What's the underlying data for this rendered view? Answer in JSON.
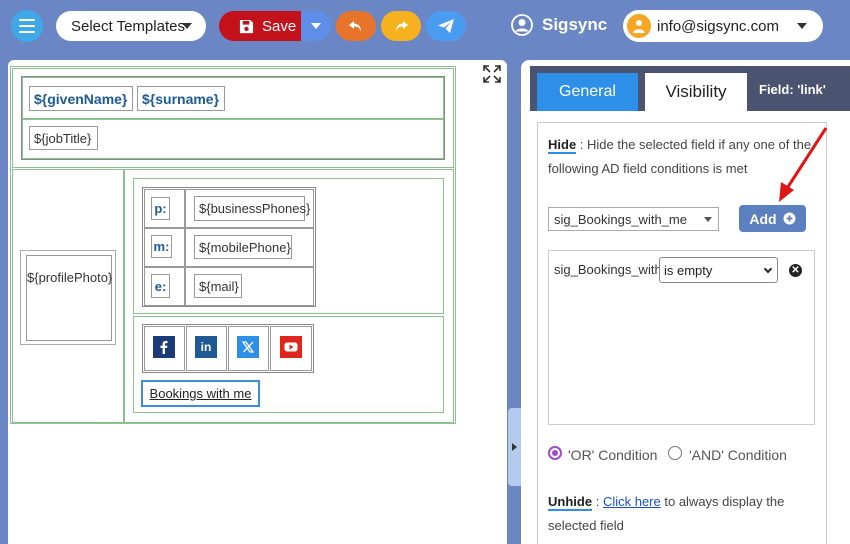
{
  "toolbar": {
    "templates_label": "Select Templates",
    "save_label": "Save",
    "brand": "Sigsync",
    "user_email": "info@sigsync.com"
  },
  "signature": {
    "given_name": "${givenName}",
    "surname": "${surname}",
    "job_title": "${jobTitle}",
    "photo": "${profilePhoto}",
    "phone_label": "p:",
    "phone_value": "${businessPhones}",
    "mobile_label": "m:",
    "mobile_value": "${mobilePhone}",
    "email_label": "e:",
    "email_value": "${mail}",
    "booking_label": "Bookings with me"
  },
  "panel": {
    "tab_general": "General",
    "tab_visibility": "Visibility",
    "field_prefix": "Field:",
    "field_name": "'link'",
    "hide_label": "Hide",
    "hide_desc_1": ": Hide the selected field if any one of the",
    "hide_desc_2": "following AD field conditions is met",
    "ad_field_value": "sig_Bookings_with_me",
    "add_label": "Add",
    "condition_field": "sig_Bookings_with",
    "condition_operator": "is empty",
    "or_label": "'OR' Condition",
    "and_label": "'AND' Condition",
    "unhide_label": "Unhide",
    "unhide_sep": ":",
    "unhide_link": "Click here",
    "unhide_desc_1": "to always display the",
    "unhide_desc_2": "selected field"
  },
  "colors": {
    "background": "#6b86c4",
    "save": "#c4121c",
    "accent_blue": "#2d8fe8",
    "undo": "#e8732a",
    "redo": "#f5b21e",
    "send": "#4a9cf0",
    "radio_selected": "#9b4dc9"
  },
  "icons": [
    "hamburger-icon",
    "save-icon",
    "undo-icon",
    "redo-icon",
    "send-icon",
    "user-circle-icon",
    "avatar-icon",
    "expand-icon",
    "plus-circle-icon",
    "close-icon",
    "facebook-icon",
    "linkedin-icon",
    "x-icon",
    "youtube-icon"
  ]
}
